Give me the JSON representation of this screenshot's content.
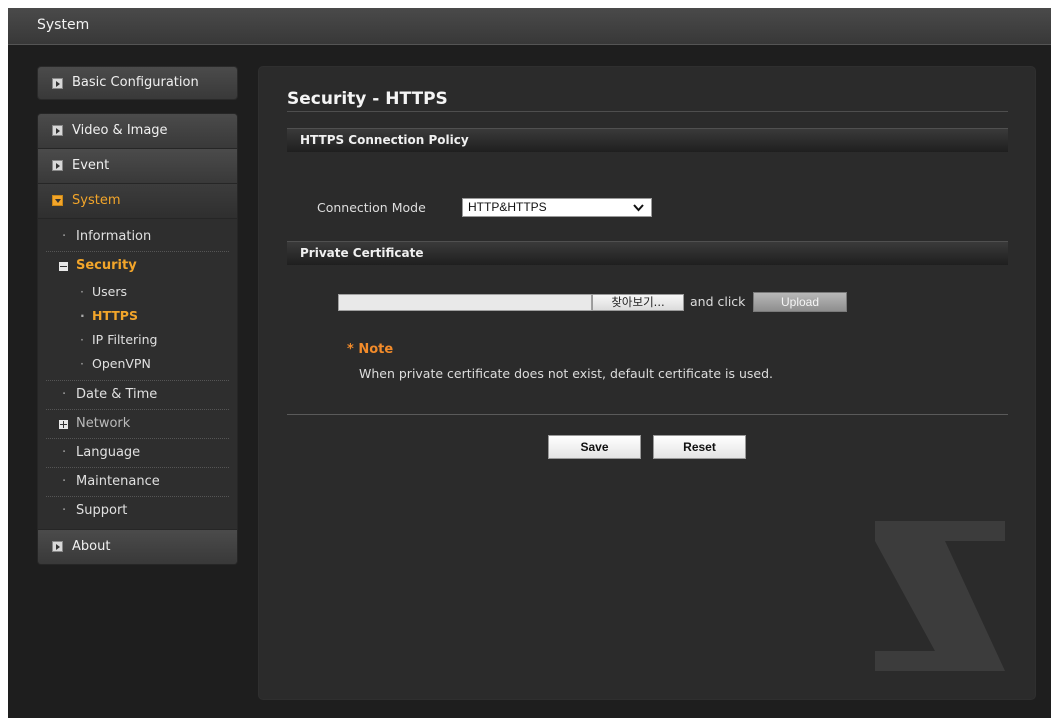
{
  "header": {
    "title": "System"
  },
  "sidebar": {
    "basic_configuration": "Basic Configuration",
    "video_image": "Video & Image",
    "event": "Event",
    "system": "System",
    "system_items": {
      "information": "Information",
      "security": "Security",
      "security_items": [
        "Users",
        "HTTPS",
        "IP Filtering",
        "OpenVPN"
      ],
      "date_time": "Date & Time",
      "network": "Network",
      "language": "Language",
      "maintenance": "Maintenance",
      "support": "Support"
    },
    "about": "About"
  },
  "main": {
    "title": "Security - HTTPS",
    "connection_policy": {
      "heading": "HTTPS Connection Policy",
      "mode_label": "Connection Mode",
      "mode_value": "HTTP&HTTPS"
    },
    "private_certificate": {
      "heading": "Private Certificate",
      "file_value": "",
      "browse_label": "찾아보기...",
      "and_click": "and click",
      "upload_label": "Upload"
    },
    "note": {
      "title": "* Note",
      "text": "When private certificate does not exist, default certificate is used."
    },
    "actions": {
      "save": "Save",
      "reset": "Reset"
    }
  },
  "colors": {
    "accent": "#f2a52a",
    "note": "#f28b2a",
    "panel": "#2b2b2b",
    "background": "#1e1e1e"
  },
  "icons": [
    "chevron-down-icon",
    "expand-arrow-icon",
    "collapse-arrow-icon",
    "minus-square-icon",
    "plus-square-icon"
  ]
}
